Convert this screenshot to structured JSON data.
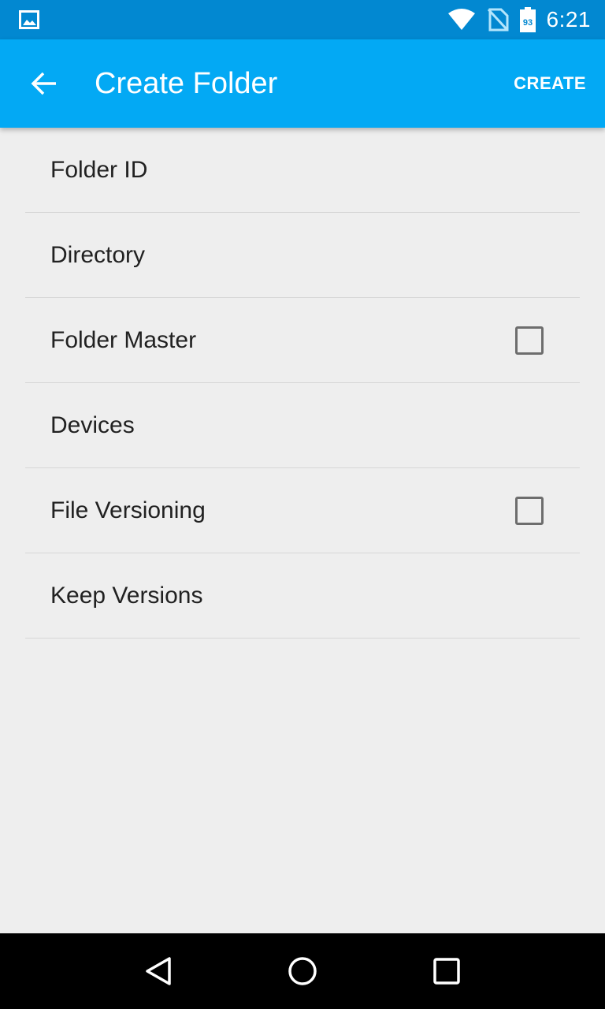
{
  "status_bar": {
    "time": "6:21",
    "battery_level": "93",
    "icons": [
      "image-notification-icon",
      "wifi-icon",
      "no-sim-icon",
      "battery-icon"
    ]
  },
  "app_bar": {
    "title": "Create Folder",
    "action_label": "CREATE",
    "back_icon": "arrow-back-icon",
    "color": "#03a9f4",
    "status_color": "#0288d1"
  },
  "form": {
    "rows": [
      {
        "label": "Folder ID",
        "checkbox": false
      },
      {
        "label": "Directory",
        "checkbox": false
      },
      {
        "label": "Folder Master",
        "checkbox": true,
        "checked": false
      },
      {
        "label": "Devices",
        "checkbox": false
      },
      {
        "label": "File Versioning",
        "checkbox": true,
        "checked": false
      },
      {
        "label": "Keep Versions",
        "checkbox": false
      }
    ]
  },
  "nav_bar": {
    "icons": [
      "back-triangle-icon",
      "home-circle-icon",
      "recents-square-icon"
    ]
  }
}
